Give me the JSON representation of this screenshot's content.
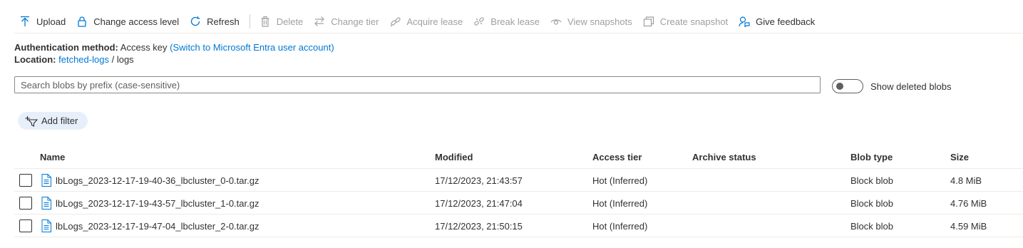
{
  "toolbar": {
    "buttons": [
      {
        "label": "Upload",
        "icon": "upload-icon",
        "enabled": true
      },
      {
        "label": "Change access level",
        "icon": "lock-icon",
        "enabled": true
      },
      {
        "label": "Refresh",
        "icon": "refresh-icon",
        "enabled": true
      },
      {
        "label": "Delete",
        "icon": "trash-icon",
        "enabled": false
      },
      {
        "label": "Change tier",
        "icon": "swap-icon",
        "enabled": false
      },
      {
        "label": "Acquire lease",
        "icon": "link-icon",
        "enabled": false
      },
      {
        "label": "Break lease",
        "icon": "broken-link-icon",
        "enabled": false
      },
      {
        "label": "View snapshots",
        "icon": "eye-icon",
        "enabled": false
      },
      {
        "label": "Create snapshot",
        "icon": "snapshot-icon",
        "enabled": false
      },
      {
        "label": "Give feedback",
        "icon": "feedback-icon",
        "enabled": true
      }
    ]
  },
  "auth": {
    "label": "Authentication method:",
    "value": "Access key",
    "switch_link": "(Switch to Microsoft Entra user account)"
  },
  "location": {
    "label": "Location:",
    "container": "fetched-logs",
    "separator": "/",
    "folder": "logs"
  },
  "search": {
    "placeholder": "Search blobs by prefix (case-sensitive)",
    "value": ""
  },
  "show_deleted": {
    "label": "Show deleted blobs",
    "on": false
  },
  "add_filter": {
    "label": "Add filter"
  },
  "table": {
    "headers": {
      "name": "Name",
      "modified": "Modified",
      "access_tier": "Access tier",
      "archive_status": "Archive status",
      "blob_type": "Blob type",
      "size": "Size"
    },
    "rows": [
      {
        "name": "lbLogs_2023-12-17-19-40-36_lbcluster_0-0.tar.gz",
        "modified": "17/12/2023, 21:43:57",
        "access_tier": "Hot (Inferred)",
        "archive_status": "",
        "blob_type": "Block blob",
        "size": "4.8 MiB"
      },
      {
        "name": "lbLogs_2023-12-17-19-43-57_lbcluster_1-0.tar.gz",
        "modified": "17/12/2023, 21:47:04",
        "access_tier": "Hot (Inferred)",
        "archive_status": "",
        "blob_type": "Block blob",
        "size": "4.76 MiB"
      },
      {
        "name": "lbLogs_2023-12-17-19-47-04_lbcluster_2-0.tar.gz",
        "modified": "17/12/2023, 21:50:15",
        "access_tier": "Hot (Inferred)",
        "archive_status": "",
        "blob_type": "Block blob",
        "size": "4.59 MiB"
      }
    ]
  },
  "colors": {
    "accent": "#0078d4",
    "text": "#323130",
    "disabled": "#a19f9d",
    "filter_pill": "#e7f0fa",
    "divider": "#edebe9"
  }
}
